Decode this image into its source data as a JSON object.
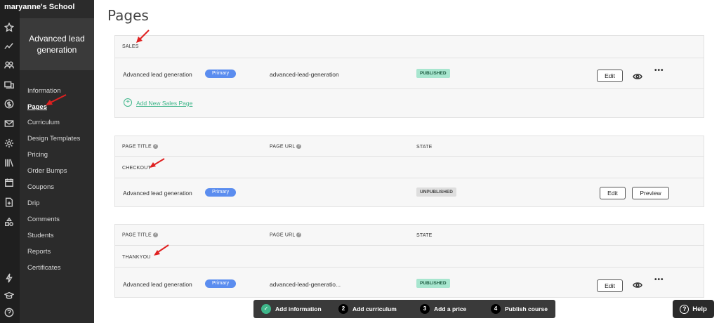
{
  "school": {
    "name": "maryanne's School"
  },
  "rail_icons": [
    "star-icon",
    "trend-icon",
    "users-icon",
    "devices-icon",
    "dollar-icon",
    "mail-icon",
    "gear-icon",
    "library-icon",
    "calendar-icon",
    "file-plus-icon",
    "shapes-icon",
    "bolt-icon",
    "graduation-icon",
    "help-circle-icon"
  ],
  "course": {
    "title": "Advanced lead generation"
  },
  "nav": {
    "items": [
      "Information",
      "Pages",
      "Curriculum",
      "Design Templates",
      "Pricing",
      "Order Bumps",
      "Coupons",
      "Drip",
      "Comments",
      "Students",
      "Reports",
      "Certificates"
    ],
    "active": "Pages"
  },
  "page": {
    "title": "Pages"
  },
  "sales": {
    "section_label": "SALES",
    "row": {
      "title": "Advanced lead generation",
      "badge": "Primary",
      "url": "advanced-lead-generation",
      "state": "PUBLISHED",
      "edit": "Edit"
    },
    "add_label": "Add New Sales Page"
  },
  "checkout": {
    "col_title": "PAGE TITLE",
    "col_url": "PAGE URL",
    "col_state": "STATE",
    "section_label": "CHECKOUT",
    "row": {
      "title": "Advanced lead generation",
      "badge": "Primary",
      "state": "UNPUBLISHED",
      "edit": "Edit",
      "preview": "Preview"
    }
  },
  "thankyou": {
    "col_title": "PAGE TITLE",
    "col_url": "PAGE URL",
    "col_state": "STATE",
    "section_label": "THANKYOU",
    "row": {
      "title": "Advanced lead generation",
      "badge": "Primary",
      "url": "advanced-lead-generatio...",
      "state": "PUBLISHED",
      "edit": "Edit"
    }
  },
  "stepper": {
    "steps": [
      {
        "num": "✓",
        "label": "Add information"
      },
      {
        "num": "2",
        "label": "Add curriculum"
      },
      {
        "num": "3",
        "label": "Add a price"
      },
      {
        "num": "4",
        "label": "Publish course"
      }
    ]
  },
  "help": {
    "label": "Help"
  },
  "colors": {
    "accent_green": "#3fb68a",
    "primary_badge": "#5b8def",
    "published_bg": "#a8e6cf",
    "arrow_red": "#e02020"
  }
}
